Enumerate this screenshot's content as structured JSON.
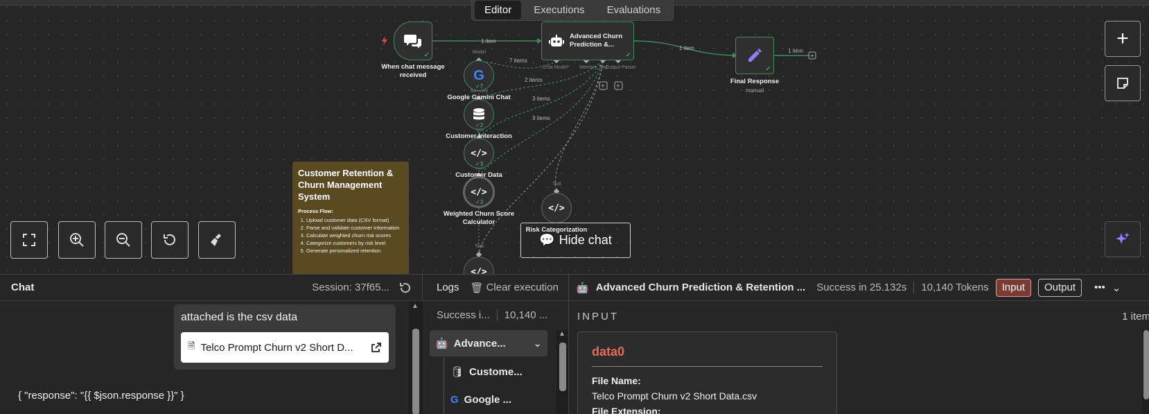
{
  "tabs": [
    {
      "label": "Editor",
      "active": true
    },
    {
      "label": "Executions",
      "active": false
    },
    {
      "label": "Evaluations",
      "active": false
    }
  ],
  "nodes": {
    "trigger": {
      "label": "When chat message received"
    },
    "agent": {
      "label": "Advanced Churn Prediction &...",
      "ports": [
        "Chat Model*",
        "Memory",
        "Tool",
        "Output Parser"
      ],
      "port_top": "Model"
    },
    "final": {
      "label": "Final Response",
      "sub": "manual"
    },
    "gemini": {
      "label": "Google Gemini Chat",
      "count": "7",
      "port": "Memory"
    },
    "customer_interaction": {
      "label": "Customer Interaction",
      "count": "2",
      "port": "Tool"
    },
    "customer_data": {
      "label": "Customer Data",
      "count": "3",
      "port": "Tool"
    },
    "weighted": {
      "label": "Weighted Churn Score Calculator",
      "count": "3",
      "port": "Tool"
    },
    "risk": {
      "label": "Risk Categorization",
      "port": "Tool"
    },
    "bottom_tool": {
      "port": "Tool"
    }
  },
  "wires": {
    "w1": "1 item",
    "w2": "1 item",
    "w3": "1 item",
    "w4": "7 items",
    "w5": "2 items",
    "w6": "3 items",
    "w7": "3 items"
  },
  "sticky": {
    "title": "Customer Retention & Churn Management System",
    "subtitle": "Process Flow:",
    "steps": [
      "Upload customer data (CSV format)",
      "Parse and validate customer information",
      "Calculate weighted churn risk scores",
      "Categorize customers by risk level",
      "Generate personalized retention"
    ]
  },
  "canvas_controls": {
    "hide_chat": "Hide chat"
  },
  "chat": {
    "title": "Chat",
    "session": "Session: 37f65...",
    "message": "attached is the csv data",
    "file": "Telco Prompt Churn v2 Short D...",
    "response": "{ \"response\": \"{{ $json.response }}\" }"
  },
  "logs": {
    "title": "Logs",
    "clear": "Clear execution",
    "status": "Success i...",
    "tokens": "10,140 ...",
    "items": [
      {
        "label": "Advance..."
      },
      {
        "label": "Custome..."
      },
      {
        "label": "Google ..."
      }
    ]
  },
  "detail": {
    "title": "Advanced Churn Prediction & Retention ...",
    "status": "Success in 25.132s",
    "tokens": "10,140 Tokens",
    "input_btn": "Input",
    "output_btn": "Output",
    "section": "INPUT",
    "item_count": "1 item",
    "data_key": "data0",
    "file_name_label": "File Name:",
    "file_name_value": "Telco Prompt Churn v2 Short Data.csv",
    "file_ext_label": "File Extension:"
  },
  "colors": {
    "accent_green": "#3d8c5c",
    "input_active": "#7b3a34",
    "sticky": "#5a4a22",
    "data_key": "#e66a57"
  }
}
